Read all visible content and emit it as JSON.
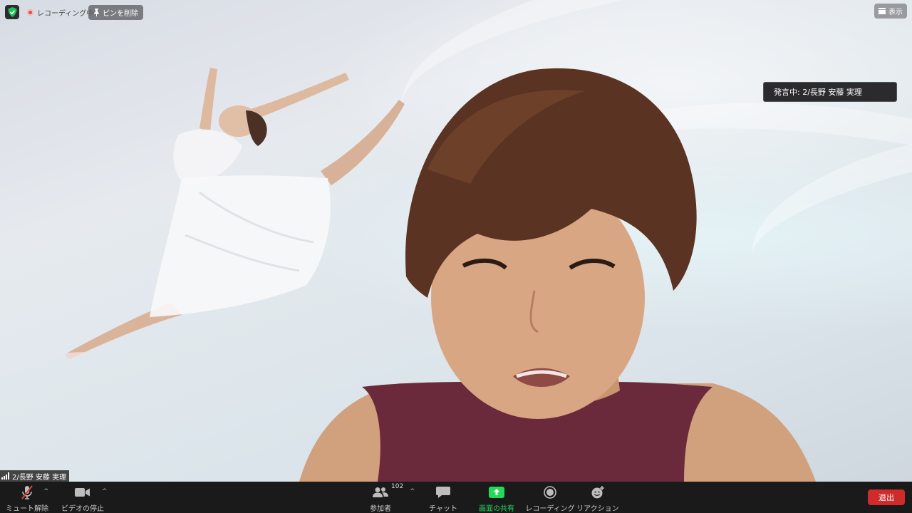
{
  "top_bar": {
    "recording_status": "レコーディング中",
    "unpin_label": "ピンを削除",
    "view_label": "表示"
  },
  "speaker_indicator": "発言中: 2/長野  安藤 実理",
  "participant_name": "2/長野  安藤 実理",
  "toolbar": {
    "mute_label": "ミュート解除",
    "video_label": "ビデオの停止",
    "participants_label": "参加者",
    "participants_count": "102",
    "chat_label": "チャット",
    "share_label": "画面の共有",
    "record_label": "レコーディング",
    "reactions_label": "リアクション",
    "leave_label": "退出"
  },
  "colors": {
    "accent_green": "#23d959",
    "leave_red": "#cf2b2b",
    "shield_green": "#1fbf5a"
  }
}
